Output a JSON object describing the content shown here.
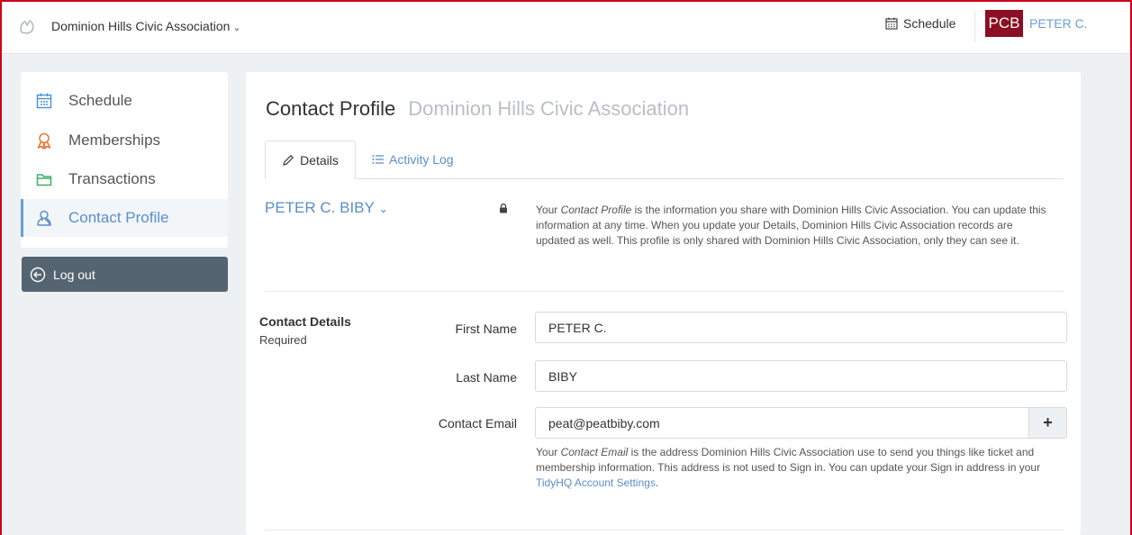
{
  "topbar": {
    "org_name": "Dominion Hills Civic Association",
    "org_chevron": "⌄",
    "schedule_label": "Schedule",
    "avatar_initials": "PCB",
    "user_name": "PETER C."
  },
  "sidebar": {
    "items": [
      {
        "label": "Schedule",
        "icon": "calendar-icon"
      },
      {
        "label": "Memberships",
        "icon": "ribbon-icon"
      },
      {
        "label": "Transactions",
        "icon": "folder-icon"
      },
      {
        "label": "Contact Profile",
        "icon": "user-icon"
      }
    ],
    "logout_label": "Log out"
  },
  "main": {
    "title": "Contact Profile",
    "subtitle": "Dominion Hills Civic Association",
    "tabs": [
      {
        "label": "Details",
        "icon": "pencil-icon"
      },
      {
        "label": "Activity Log",
        "icon": "list-icon"
      }
    ],
    "person_name": "PETER C. BIBY",
    "person_chevron": "⌄",
    "profile_desc": {
      "pre": "Your ",
      "em": "Contact Profile",
      "post": " is the information you share with Dominion Hills Civic Association. You can update this information at any time. When you update your Details, Dominion Hills Civic Association records are updated as well. This profile is only shared with Dominion Hills Civic Association, only they can see it."
    },
    "section_title": "Contact Details",
    "section_sub": "Required",
    "fields": {
      "first_name_label": "First Name",
      "first_name_value": "PETER C.",
      "last_name_label": "Last Name",
      "last_name_value": "BIBY",
      "email_label": "Contact Email",
      "email_value": "peat@peatbiby.com"
    },
    "add_label": "+",
    "email_help": {
      "pre": "Your ",
      "em": "Contact Email",
      "mid": " is the address Dominion Hills Civic Association use to send you things like ticket and membership information. This address is not used to Sign in. You can update your Sign in address in your ",
      "link": "TidyHQ Account Settings",
      "post": "."
    }
  },
  "colors": {
    "accent": "#5b8ec8",
    "avatar_bg": "#8b0e22",
    "logout_bg": "#556471",
    "memberships_icon": "#e8772e",
    "transactions_icon": "#3fae6a"
  }
}
